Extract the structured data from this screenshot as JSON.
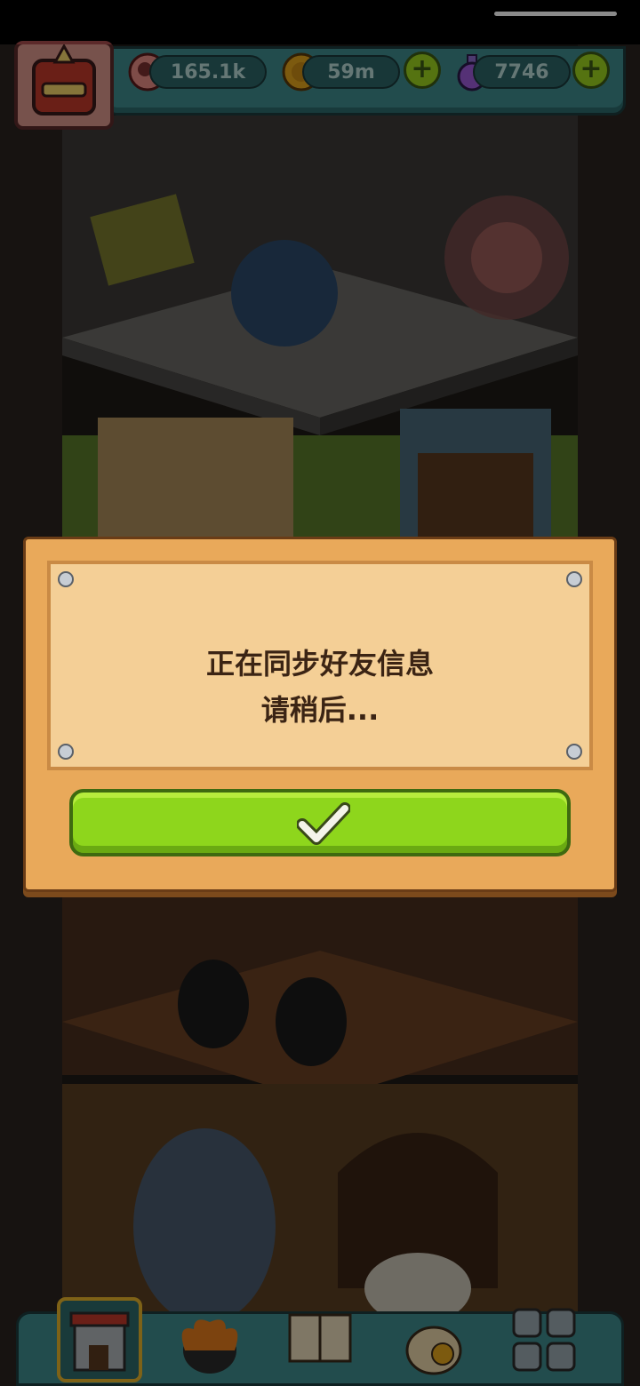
{
  "resources": {
    "eyeballs": {
      "value": "165.1k",
      "icon": "eyeball-icon"
    },
    "coins": {
      "value": "59m",
      "icon": "coin-icon"
    },
    "potions": {
      "value": "7746",
      "icon": "potion-icon"
    }
  },
  "dialog": {
    "message_line1": "正在同步好友信息",
    "message_line2": "请稍后...",
    "confirm_icon": "checkmark-icon"
  },
  "bottom_nav": [
    {
      "name": "tower-icon",
      "active": true
    },
    {
      "name": "furnace-icon",
      "active": false
    },
    {
      "name": "book-icon",
      "active": false
    },
    {
      "name": "money-bag-icon",
      "active": false
    },
    {
      "name": "grid-icon",
      "active": false
    }
  ],
  "colors": {
    "panel_teal": "#3e8a8c",
    "confirm_green": "#8ed61c",
    "dialog_wood": "#e9a95a",
    "dialog_paper": "#f4cf96",
    "text_dark_brown": "#3b2414"
  }
}
